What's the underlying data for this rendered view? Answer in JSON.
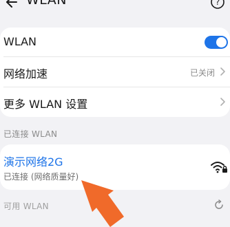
{
  "header": {
    "title": "WLAN",
    "back_icon": "back-arrow-icon",
    "help_icon": "help-icon"
  },
  "settings": {
    "wlan_label": "WLAN",
    "wlan_enabled": true,
    "network_boost_label": "网络加速",
    "network_boost_value": "已关闭",
    "more_settings_label": "更多 WLAN 设置"
  },
  "connected": {
    "section_label": "已连接 WLAN",
    "network_name": "演示网络2G",
    "network_status": "已连接 (网络质量好)"
  },
  "available": {
    "section_label": "可用 WLAN"
  },
  "colors": {
    "accent": "#1e74e8",
    "arrow": "#f06a2a",
    "background": "#f2f2f5"
  }
}
